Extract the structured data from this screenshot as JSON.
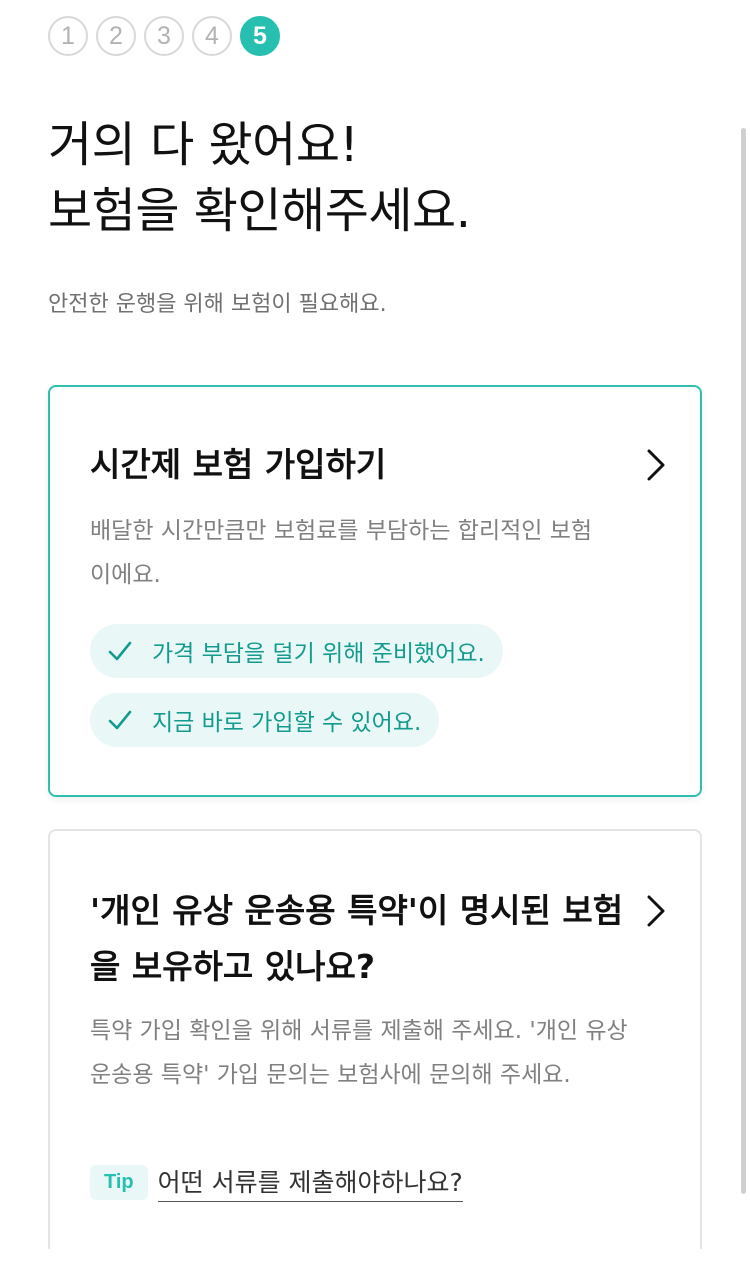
{
  "steps": [
    "1",
    "2",
    "3",
    "4",
    "5"
  ],
  "active_step": "5",
  "header": {
    "title_line1": "거의 다 왔어요!",
    "title_line2": "보험을 확인해주세요.",
    "subtitle": "안전한 운행을 위해 보험이 필요해요."
  },
  "colors": {
    "accent": "#26bfb0",
    "pill_bg": "#e9f8f6",
    "pill_text": "#139b8e"
  },
  "cards": [
    {
      "title": "시간제 보험 가입하기",
      "description": "배달한 시간만큼만 보험료를 부담하는 합리적인 보험이에요.",
      "features": [
        "가격 부담을 덜기 위해 준비했어요.",
        "지금 바로 가입할 수 있어요."
      ],
      "icons": [
        "chevron-right-icon",
        "check-icon"
      ]
    },
    {
      "title": "'개인 유상 운송용 특약'이 명시된 보험을 보유하고 있나요?",
      "description": "특약 가입 확인을 위해 서류를 제출해 주세요. '개인 유상 운송용 특약' 가입 문의는 보험사에 문의해 주세요.",
      "tip_badge": "Tip",
      "tip_link": "어떤 서류를 제출해야하나요?"
    }
  ]
}
